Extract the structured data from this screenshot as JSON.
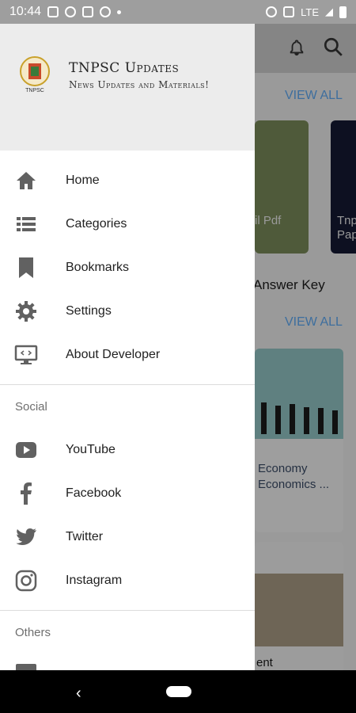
{
  "status_bar": {
    "time": "10:44",
    "network": "LTE"
  },
  "drawer": {
    "app_title": "TNPSC Updates",
    "app_subtitle": "News Updates and Materials!",
    "logo_text": "TNPSC",
    "main_items": [
      {
        "label": "Home",
        "icon": "home-icon"
      },
      {
        "label": "Categories",
        "icon": "list-icon"
      },
      {
        "label": "Bookmarks",
        "icon": "bookmark-icon"
      },
      {
        "label": "Settings",
        "icon": "gear-icon"
      },
      {
        "label": "About Developer",
        "icon": "monitor-code-icon"
      }
    ],
    "social_header": "Social",
    "social_items": [
      {
        "label": "YouTube",
        "icon": "youtube-icon"
      },
      {
        "label": "Facebook",
        "icon": "facebook-icon"
      },
      {
        "label": "Twitter",
        "icon": "twitter-icon"
      },
      {
        "label": "Instagram",
        "icon": "instagram-icon"
      }
    ],
    "others_header": "Others"
  },
  "background": {
    "view_all_1": "VIEW ALL",
    "view_all_2": "VIEW ALL",
    "card1_text": "il Pdf",
    "card2_text": "Tnp Pap",
    "answer_key": "Answer Key",
    "card3_text": "Economy Economics ...",
    "card4_text": "ent"
  },
  "colors": {
    "accent": "#2f6fb0",
    "drawer_header_bg": "#ececec",
    "icon": "#616161"
  }
}
